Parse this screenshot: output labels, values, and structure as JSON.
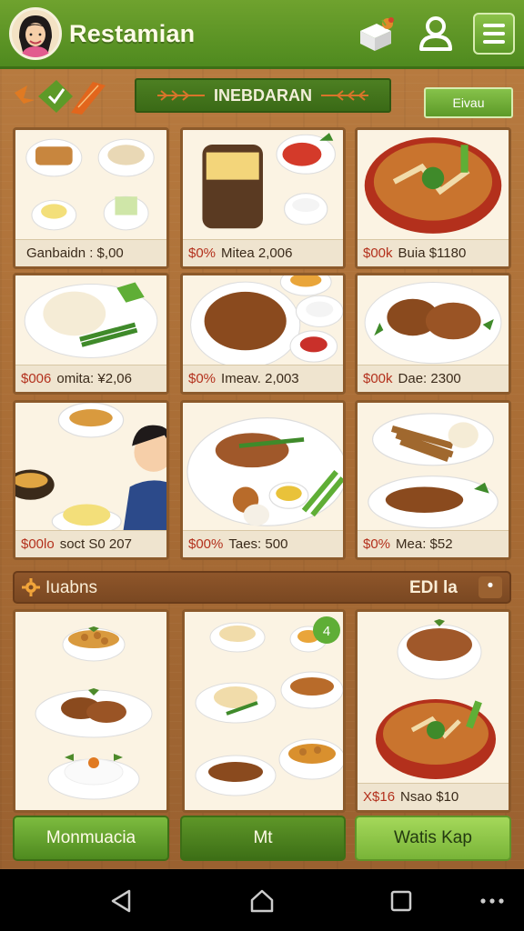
{
  "app": {
    "title": "Restamian"
  },
  "banner": {
    "title": "INEBDARAN",
    "button_label": "Eivau"
  },
  "grid": [
    {
      "name": "breads",
      "price_pct": "",
      "price_text": "Ganbaidn : $,00"
    },
    {
      "name": "jar-and-sauces",
      "price_pct": "$0%",
      "price_text": "Mitea 2,006"
    },
    {
      "name": "curry-bowl",
      "price_pct": "$00k",
      "price_text": "Buia $1180"
    },
    {
      "name": "rice-beans",
      "price_pct": "$006",
      "price_text": "omita: ¥2,06"
    },
    {
      "name": "fried-rice",
      "price_pct": "$0%",
      "price_text": "Imeav. 2,003"
    },
    {
      "name": "roast-chicken",
      "price_pct": "$00k",
      "price_text": "Dae: 2300"
    },
    {
      "name": "woman-eating",
      "price_pct": "$00lo",
      "price_text": "soct S0 207"
    },
    {
      "name": "mixed-platter",
      "price_pct": "$00%",
      "price_text": "Taes: 500"
    },
    {
      "name": "skewers",
      "price_pct": "$0%",
      "price_text": "Mea: $52"
    }
  ],
  "section": {
    "title": "Iuabns",
    "right_label": "EDI la",
    "more_icon": "•"
  },
  "bottom_cards": [
    {
      "name": "beans-chicken-rice",
      "price_pct": "",
      "price_text": ""
    },
    {
      "name": "five-dishes",
      "badge": "4",
      "price_pct": "",
      "price_text": ""
    },
    {
      "name": "chicken-soup",
      "price_pct": "X$16",
      "price_text": "Nsao $10"
    }
  ],
  "buttons": {
    "left": "Monmuacia",
    "center": "Mt",
    "right": "Watis Kap"
  },
  "colors": {
    "brand_green": "#5d9a28",
    "wood": "#a86c35",
    "price_red": "#b3301c"
  }
}
